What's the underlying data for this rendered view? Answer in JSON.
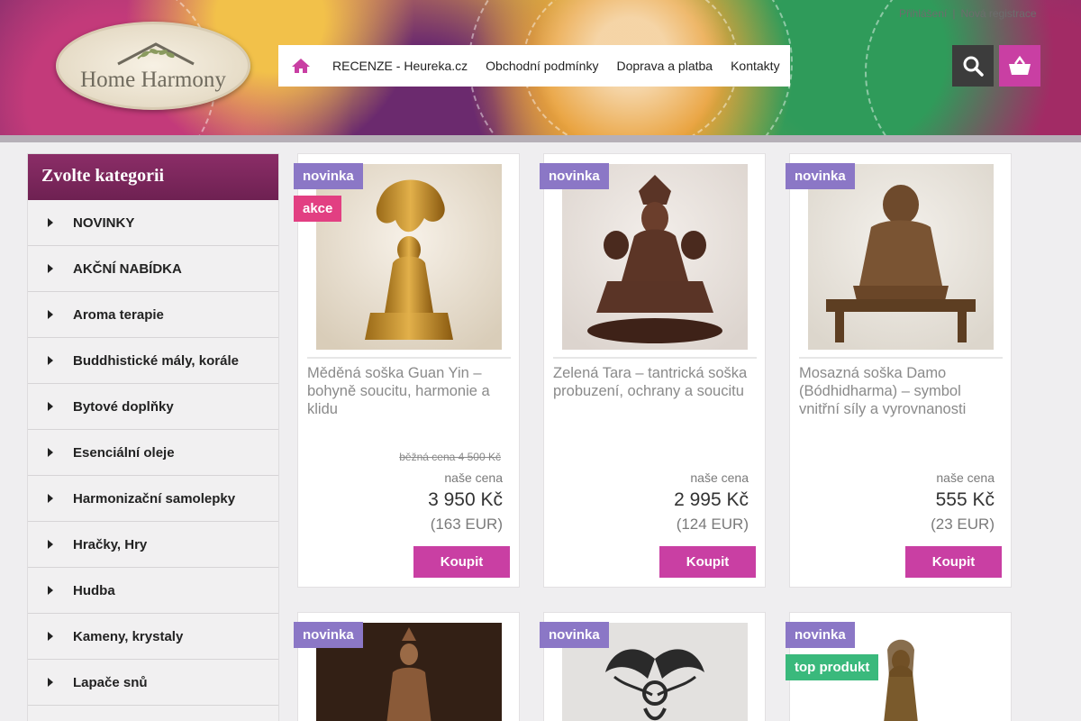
{
  "header": {
    "logo_text": "Home Harmony",
    "login": "Přihlášení",
    "register": "Nová registrace"
  },
  "nav": {
    "items": [
      "RECENZE - Heureka.cz",
      "Obchodní podmínky",
      "Doprava a platba",
      "Kontakty"
    ]
  },
  "sidebar": {
    "title": "Zvolte kategorii",
    "items": [
      {
        "label": "NOVINKY"
      },
      {
        "label": "AKČNÍ NABÍDKA"
      },
      {
        "label": "Aroma terapie"
      },
      {
        "label": "Buddhistické mály, korále"
      },
      {
        "label": "Bytové doplňky"
      },
      {
        "label": "Esenciální oleje"
      },
      {
        "label": "Harmonizační samolepky"
      },
      {
        "label": "Hračky, Hry"
      },
      {
        "label": "Hudba"
      },
      {
        "label": "Kameny, krystaly"
      },
      {
        "label": "Lapače snů"
      },
      {
        "label": ""
      }
    ]
  },
  "products": [
    {
      "name": "Měděná soška Guan Yin – bohyně soucitu, harmonie a klidu",
      "old_price": "běžná cena 4 500 Kč",
      "price_label": "naše cena",
      "price": "3 950 Kč",
      "eur": "(163 EUR)",
      "buy": "Koupit",
      "badges": [
        "novinka",
        "akce"
      ]
    },
    {
      "name": "Zelená Tara – tantrická soška probuzení, ochrany a soucitu",
      "old_price": "",
      "price_label": "naše cena",
      "price": "2 995 Kč",
      "eur": "(124 EUR)",
      "buy": "Koupit",
      "badges": [
        "novinka"
      ]
    },
    {
      "name": "Mosazná soška Damo (Bódhidharma) – symbol vnitřní síly a vyrovnanosti",
      "old_price": "",
      "price_label": "naše cena",
      "price": "555 Kč",
      "eur": "(23 EUR)",
      "buy": "Koupit",
      "badges": [
        "novinka"
      ]
    },
    {
      "name": "",
      "old_price": "",
      "price_label": "",
      "price": "",
      "eur": "",
      "buy": "",
      "badges": [
        "novinka"
      ]
    },
    {
      "name": "",
      "old_price": "",
      "price_label": "",
      "price": "",
      "eur": "",
      "buy": "",
      "badges": [
        "novinka"
      ]
    },
    {
      "name": "",
      "old_price": "",
      "price_label": "",
      "price": "",
      "eur": "",
      "buy": "",
      "badges": [
        "novinka",
        "top produkt"
      ]
    }
  ],
  "colors": {
    "accent": "#c93fa3",
    "sidebar_header": "#7a2659",
    "badge_new": "#8b77c6",
    "badge_sale": "#e23f82",
    "badge_top": "#3ab97c"
  }
}
